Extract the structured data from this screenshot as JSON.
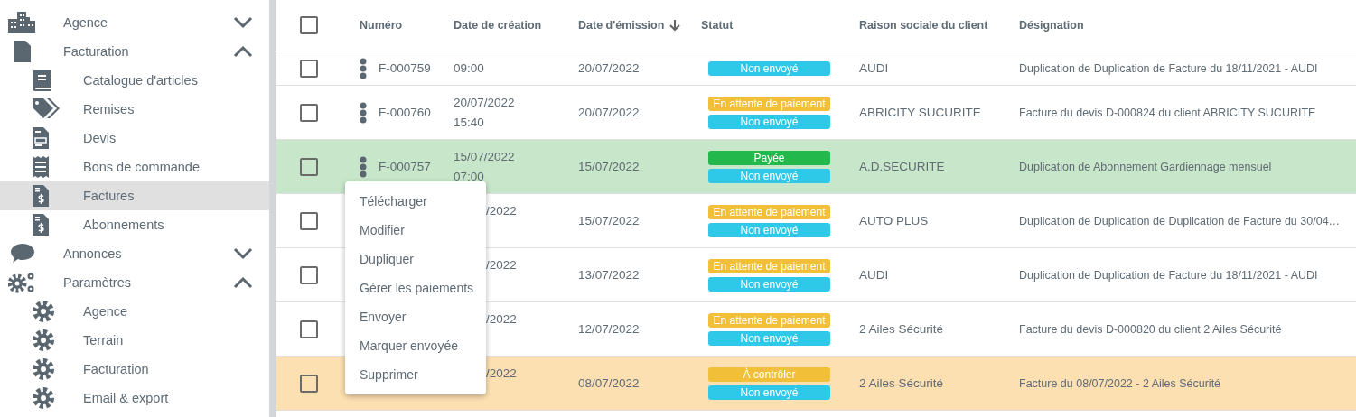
{
  "sidebar": {
    "groups": [
      {
        "label": "Agence",
        "expanded": false
      },
      {
        "label": "Facturation",
        "expanded": true,
        "children": [
          {
            "label": "Catalogue d'articles",
            "selected": false
          },
          {
            "label": "Remises",
            "selected": false
          },
          {
            "label": "Devis",
            "selected": false
          },
          {
            "label": "Bons de commande",
            "selected": false
          },
          {
            "label": "Factures",
            "selected": true
          },
          {
            "label": "Abonnements",
            "selected": false
          }
        ]
      },
      {
        "label": "Annonces",
        "expanded": false
      },
      {
        "label": "Paramètres",
        "expanded": true,
        "children": [
          {
            "label": "Agence",
            "selected": false
          },
          {
            "label": "Terrain",
            "selected": false
          },
          {
            "label": "Facturation",
            "selected": false
          },
          {
            "label": "Email & export",
            "selected": false
          }
        ]
      }
    ]
  },
  "table": {
    "select_all": {
      "checked": false
    },
    "columns": [
      {
        "label": "Numéro",
        "sorted": false
      },
      {
        "label": "Date de création",
        "sorted": false
      },
      {
        "label": "Date d'émission",
        "sorted": true
      },
      {
        "label": "Statut",
        "sorted": false
      },
      {
        "label": "Raison sociale du client",
        "sorted": false
      },
      {
        "label": "Désignation",
        "sorted": false
      }
    ],
    "rows": [
      {
        "checked": false,
        "number": "F-000759",
        "created": [
          "09:00"
        ],
        "covered": false,
        "issued": "20/07/2022",
        "statuses": [
          {
            "label": "Non envoyé",
            "color": "#2ec9e8"
          }
        ],
        "client": "AUDI",
        "designation": "Duplication de Duplication de Facture du 18/11/2021 - AUDI"
      },
      {
        "checked": false,
        "number": "F-000760",
        "created": [
          "20/07/2022",
          "15:40"
        ],
        "covered": false,
        "issued": "20/07/2022",
        "statuses": [
          {
            "label": "En attente de paiement",
            "color": "#f1c038"
          },
          {
            "label": "Non envoyé",
            "color": "#2ec9e8"
          }
        ],
        "client": "ABRICITY SUCURITE",
        "designation": "Facture du devis D-000824 du client ABRICITY SUCURITE"
      },
      {
        "checked": false,
        "number": "F-000757",
        "created": [
          "15/07/2022",
          "07:00"
        ],
        "covered": false,
        "issued": "15/07/2022",
        "statuses": [
          {
            "label": "Payée",
            "color": "#22b84c"
          },
          {
            "label": "Non envoyé",
            "color": "#2ec9e8"
          }
        ],
        "client": "A.D.SECURITE",
        "designation": "Duplication de Abonnement Gardiennage mensuel",
        "color": "#c8e6c9"
      },
      {
        "checked": false,
        "number": "",
        "created": [
          "/2022"
        ],
        "covered": true,
        "issued": "15/07/2022",
        "statuses": [
          {
            "label": "En attente de paiement",
            "color": "#f1c038"
          },
          {
            "label": "Non envoyé",
            "color": "#2ec9e8"
          }
        ],
        "client": "AUTO PLUS",
        "designation": "Duplication de Duplication de Duplication de Facture du 30/04…"
      },
      {
        "checked": false,
        "number": "",
        "created": [
          "/2022"
        ],
        "covered": true,
        "issued": "13/07/2022",
        "statuses": [
          {
            "label": "En attente de paiement",
            "color": "#f1c038"
          },
          {
            "label": "Non envoyé",
            "color": "#2ec9e8"
          }
        ],
        "client": "AUDI",
        "designation": "Duplication de Duplication de Facture du 18/11/2021 - AUDI"
      },
      {
        "checked": false,
        "number": "",
        "created": [
          "/2022"
        ],
        "covered": true,
        "issued": "12/07/2022",
        "statuses": [
          {
            "label": "En attente de paiement",
            "color": "#f1c038"
          },
          {
            "label": "Non envoyé",
            "color": "#2ec9e8"
          }
        ],
        "client": "2 Ailes Sécurité",
        "designation": "Facture du devis D-000820 du client 2 Ailes Sécurité"
      },
      {
        "checked": false,
        "number": "",
        "created": [
          "/2022"
        ],
        "covered": true,
        "issued": "08/07/2022",
        "statuses": [
          {
            "label": "À contrôler",
            "color": "#f1c038"
          },
          {
            "label": "Non envoyé",
            "color": "#2ec9e8"
          }
        ],
        "client": "2 Ailes Sécurité",
        "designation": "Facture du 08/07/2022 - 2 Ailes Sécurité",
        "color": "#fde0b2"
      }
    ]
  },
  "context_menu": {
    "items": [
      "Télécharger",
      "Modifier",
      "Dupliquer",
      "Gérer les paiements",
      "Envoyer",
      "Marquer envoyée",
      "Supprimer"
    ]
  }
}
